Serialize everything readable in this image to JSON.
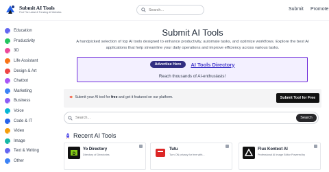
{
  "header": {
    "logo_title": "Submit AI Tools",
    "logo_subtitle": "Find The Latest & Trending AI Websites",
    "search_placeholder": "Search...",
    "nav": [
      {
        "label": "Submit"
      },
      {
        "label": "Promote"
      }
    ]
  },
  "sidebar": {
    "items": [
      {
        "label": "Education",
        "color": "#6366f1"
      },
      {
        "label": "Productivity",
        "color": "#22c55e"
      },
      {
        "label": "3D",
        "color": "#ec4899"
      },
      {
        "label": "Life Assistant",
        "color": "#f97316"
      },
      {
        "label": "Design & Art",
        "color": "#ef4444"
      },
      {
        "label": "Chatbot",
        "color": "#a855f7"
      },
      {
        "label": "Marketing",
        "color": "#3b82f6"
      },
      {
        "label": "Business",
        "color": "#8b5cf6"
      },
      {
        "label": "Voice",
        "color": "#06b6d4"
      },
      {
        "label": "Code & IT",
        "color": "#2563eb"
      },
      {
        "label": "Video",
        "color": "#f59e0b"
      },
      {
        "label": "Image",
        "color": "#14b8a6"
      },
      {
        "label": "Text & Writing",
        "color": "#6366f1"
      },
      {
        "label": "Other",
        "color": "#3b82f6"
      }
    ]
  },
  "hero": {
    "title": "Submit AI Tools",
    "description": "A handpicked selection of top AI tools designed to enhance productivity, automate tasks, and optimize workflows. Explore the best AI applications that help streamline your daily operations and improve efficiency across various tasks."
  },
  "ad": {
    "button_label": "Advertise Here",
    "link_label": "AI Tools Directory",
    "subtitle": "Reach thousands of AI-enthusiasts!"
  },
  "submit_band": {
    "text_before": "Submit your AI tool for ",
    "text_bold": "free",
    "text_after": " and get it featured on our platform.",
    "button_label": "Submit Tool for Free"
  },
  "main_search": {
    "placeholder": "Search...",
    "button_label": "Search"
  },
  "recent": {
    "heading": "Recent AI Tools",
    "cards": [
      {
        "name": "Yo Directory",
        "desc": "Directory of Directories",
        "thumb_color": "#111111",
        "thumb_icon": "yo-logo-icon"
      },
      {
        "name": "Tutu",
        "desc": "Turn ON privacy for free with...",
        "thumb_color": "#dc2626",
        "thumb_icon": "tutu-logo-icon"
      },
      {
        "name": "Flux Kontext AI",
        "desc": "Professional AI Image Editor Powered by",
        "thumb_color": "#111111",
        "thumb_icon": "flux-logo-icon"
      }
    ]
  }
}
